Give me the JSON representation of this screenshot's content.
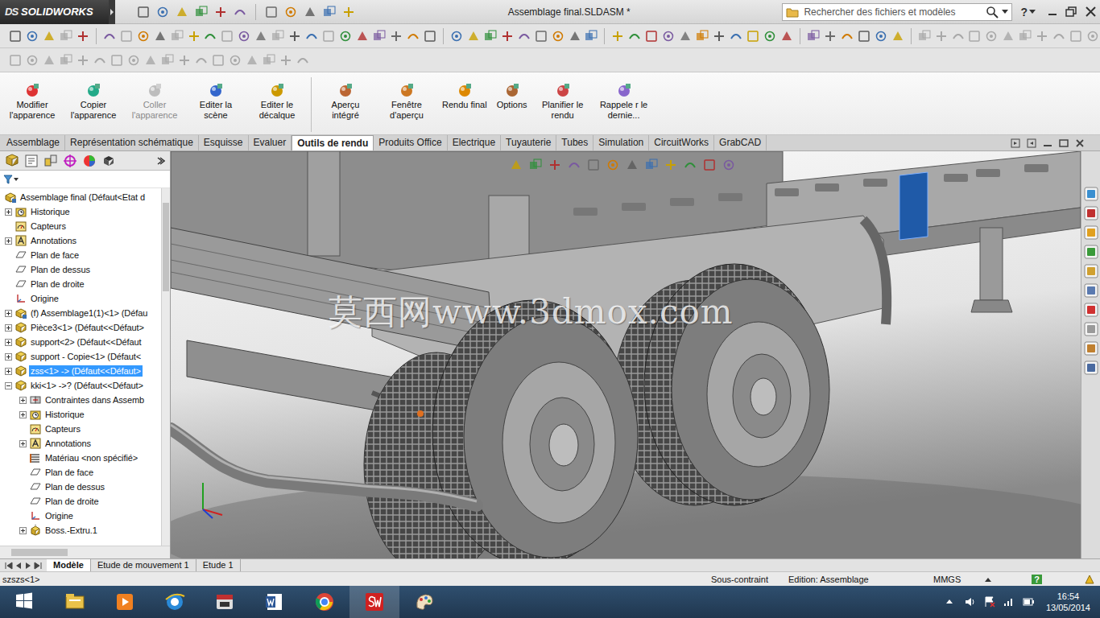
{
  "app": {
    "logo_mark": "DS",
    "logo": "SOLIDWORKS"
  },
  "window": {
    "title": "Assemblage final.SLDASM *",
    "help": "?"
  },
  "search": {
    "placeholder": "Rechercher des fichiers et modèles"
  },
  "ribbon": [
    {
      "label": "Modifier l'apparence",
      "disabled": false
    },
    {
      "label": "Copier l'apparence",
      "disabled": false
    },
    {
      "label": "Coller l'apparence",
      "disabled": true
    },
    {
      "label": "Editer la scène",
      "disabled": false
    },
    {
      "label": "Editer le décalque",
      "disabled": false
    },
    {
      "label": "Aperçu intégré",
      "disabled": false
    },
    {
      "label": "Fenêtre d'aperçu",
      "disabled": false
    },
    {
      "label": "Rendu final",
      "disabled": false
    },
    {
      "label": "Options",
      "disabled": false
    },
    {
      "label": "Planifier le rendu",
      "disabled": false
    },
    {
      "label": "Rappele r le dernie...",
      "disabled": false
    }
  ],
  "tabs": [
    {
      "label": "Assemblage",
      "selected": false
    },
    {
      "label": "Représentation schématique",
      "selected": false
    },
    {
      "label": "Esquisse",
      "selected": false
    },
    {
      "label": "Evaluer",
      "selected": false
    },
    {
      "label": "Outils de rendu",
      "selected": true
    },
    {
      "label": "Produits Office",
      "selected": false
    },
    {
      "label": "Electrique",
      "selected": false
    },
    {
      "label": "Tuyauterie",
      "selected": false
    },
    {
      "label": "Tubes",
      "selected": false
    },
    {
      "label": "Simulation",
      "selected": false
    },
    {
      "label": "CircuitWorks",
      "selected": false
    },
    {
      "label": "GrabCAD",
      "selected": false
    }
  ],
  "tree": {
    "items": [
      {
        "label": "Assemblage final  (Défaut<Etat d",
        "level": 0,
        "kind": "assembly",
        "selected": false
      },
      {
        "label": "Historique",
        "level": 1,
        "kind": "history",
        "expanded": false,
        "selected": false
      },
      {
        "label": "Capteurs",
        "level": 1,
        "kind": "sensor",
        "selected": false
      },
      {
        "label": "Annotations",
        "level": 1,
        "kind": "annotation",
        "expanded": false,
        "selected": false
      },
      {
        "label": "Plan de face",
        "level": 1,
        "kind": "plane",
        "selected": false
      },
      {
        "label": "Plan de dessus",
        "level": 1,
        "kind": "plane",
        "selected": false
      },
      {
        "label": "Plan de droite",
        "level": 1,
        "kind": "plane",
        "selected": false
      },
      {
        "label": "Origine",
        "level": 1,
        "kind": "origin",
        "selected": false
      },
      {
        "label": "(f) Assemblage1(1)<1> (Défau",
        "level": 1,
        "kind": "assembly",
        "expanded": false,
        "selected": false
      },
      {
        "label": "Pièce3<1> (Défaut<<Défaut>",
        "level": 1,
        "kind": "part",
        "expanded": false,
        "selected": false
      },
      {
        "label": "support<2> (Défaut<<Défaut",
        "level": 1,
        "kind": "part",
        "expanded": false,
        "selected": false
      },
      {
        "label": "support - Copie<1> (Défaut<",
        "level": 1,
        "kind": "part",
        "expanded": false,
        "selected": false
      },
      {
        "label": "zss<1> -> (Défaut<<Défaut>",
        "level": 1,
        "kind": "part",
        "expanded": false,
        "selected": true
      },
      {
        "label": "kki<1> ->? (Défaut<<Défaut>",
        "level": 1,
        "kind": "part",
        "expanded": true,
        "selected": false
      },
      {
        "label": "Contraintes dans Assemb",
        "level": 2,
        "kind": "mates",
        "expanded": false,
        "selected": false
      },
      {
        "label": "Historique",
        "level": 2,
        "kind": "history",
        "expanded": false,
        "selected": false
      },
      {
        "label": "Capteurs",
        "level": 2,
        "kind": "sensor",
        "selected": false
      },
      {
        "label": "Annotations",
        "level": 2,
        "kind": "annotation",
        "expanded": false,
        "selected": false
      },
      {
        "label": "Matériau <non spécifié>",
        "level": 2,
        "kind": "material",
        "selected": false
      },
      {
        "label": "Plan de face",
        "level": 2,
        "kind": "plane",
        "selected": false
      },
      {
        "label": "Plan de dessus",
        "level": 2,
        "kind": "plane",
        "selected": false
      },
      {
        "label": "Plan de droite",
        "level": 2,
        "kind": "plane",
        "selected": false
      },
      {
        "label": "Origine",
        "level": 2,
        "kind": "origin",
        "selected": false
      },
      {
        "label": "Boss.-Extru.1",
        "level": 2,
        "kind": "feature",
        "expanded": false,
        "selected": false
      }
    ]
  },
  "viewport": {
    "watermark": "莫西网www.3dmox.com"
  },
  "bottom_tabs": [
    {
      "label": "Modèle",
      "selected": true
    },
    {
      "label": "Etude de mouvement 1",
      "selected": false
    },
    {
      "label": "Etude 1",
      "selected": false
    }
  ],
  "status_bar": {
    "selection": "szszs<1>",
    "state": "Sous-contraint",
    "mode": "Edition: Assemblage",
    "units": "MMGS",
    "help": "?"
  },
  "taskbar": {
    "time": "16:54",
    "date": "13/05/2014"
  }
}
